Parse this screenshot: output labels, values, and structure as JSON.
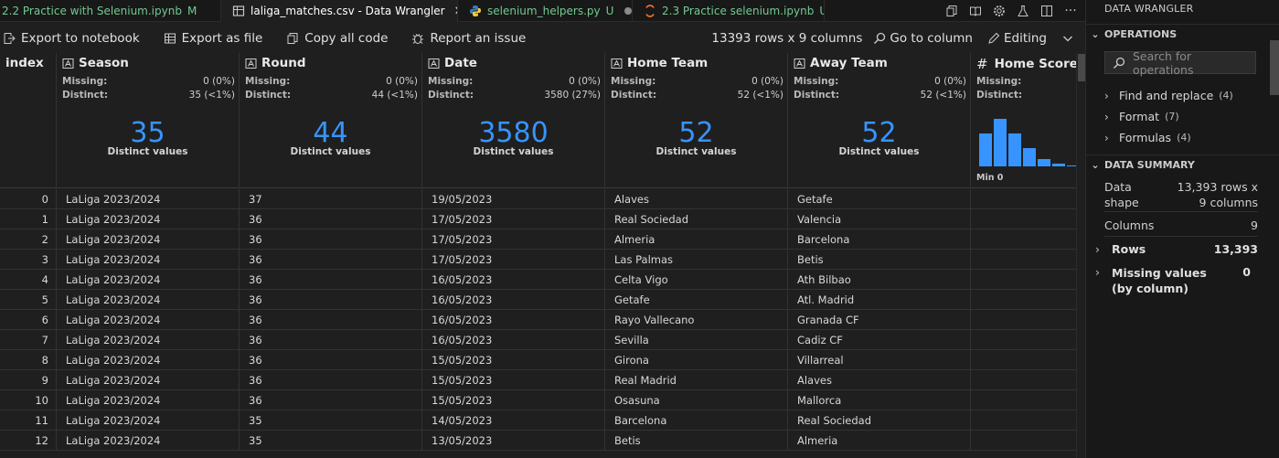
{
  "tabs": [
    {
      "label": "2.2 Practice with Selenium.ipynb",
      "badge": "M",
      "icon": "notebook-icon",
      "color": "#73c991"
    },
    {
      "label": "laliga_matches.csv - Data Wrangler",
      "icon": "table-icon",
      "close": "✕",
      "active": true
    },
    {
      "label": "selenium_helpers.py",
      "badge": "U",
      "icon": "python-icon",
      "color": "#73c991"
    },
    {
      "label": "2.3 Practice selenium.ipynb",
      "badge": "U",
      "icon": "notebook-icon",
      "color": "#73c991"
    }
  ],
  "tab_actions": [
    "copy-icon",
    "book-icon",
    "gear-icon",
    "flask-icon",
    "split-editor-icon",
    "more-icon"
  ],
  "toolbar": {
    "export_notebook": "Export to notebook",
    "export_file": "Export as file",
    "copy_code": "Copy all code",
    "report_issue": "Report an issue",
    "shape": "13393 rows x 9 columns",
    "goto_column": "Go to column",
    "editing": "Editing"
  },
  "stats_labels": {
    "missing": "Missing:",
    "distinct": "Distinct:",
    "distinct_values": "Distinct values",
    "min": "Min 0"
  },
  "columns": [
    {
      "name": "Season",
      "missing": "0 (0%)",
      "distinct": "35 (<1%)",
      "big": "35"
    },
    {
      "name": "Round",
      "missing": "0 (0%)",
      "distinct": "44 (<1%)",
      "big": "44"
    },
    {
      "name": "Date",
      "missing": "0 (0%)",
      "distinct": "3580 (27%)",
      "big": "3580"
    },
    {
      "name": "Home Team",
      "missing": "0 (0%)",
      "distinct": "52 (<1%)",
      "big": "52"
    },
    {
      "name": "Away Team",
      "missing": "0 (0%)",
      "distinct": "52 (<1%)",
      "big": "52"
    },
    {
      "name": "Home Score"
    }
  ],
  "index_header": "index",
  "rows": [
    [
      "0",
      "LaLiga 2023/2024",
      "37",
      "19/05/2023",
      "Alaves",
      "Getafe"
    ],
    [
      "1",
      "LaLiga 2023/2024",
      "36",
      "17/05/2023",
      "Real Sociedad",
      "Valencia"
    ],
    [
      "2",
      "LaLiga 2023/2024",
      "36",
      "17/05/2023",
      "Almeria",
      "Barcelona"
    ],
    [
      "3",
      "LaLiga 2023/2024",
      "36",
      "17/05/2023",
      "Las Palmas",
      "Betis"
    ],
    [
      "4",
      "LaLiga 2023/2024",
      "36",
      "16/05/2023",
      "Celta Vigo",
      "Ath Bilbao"
    ],
    [
      "5",
      "LaLiga 2023/2024",
      "36",
      "16/05/2023",
      "Getafe",
      "Atl. Madrid"
    ],
    [
      "6",
      "LaLiga 2023/2024",
      "36",
      "16/05/2023",
      "Rayo Vallecano",
      "Granada CF"
    ],
    [
      "7",
      "LaLiga 2023/2024",
      "36",
      "16/05/2023",
      "Sevilla",
      "Cadiz CF"
    ],
    [
      "8",
      "LaLiga 2023/2024",
      "36",
      "15/05/2023",
      "Girona",
      "Villarreal"
    ],
    [
      "9",
      "LaLiga 2023/2024",
      "36",
      "15/05/2023",
      "Real Madrid",
      "Alaves"
    ],
    [
      "10",
      "LaLiga 2023/2024",
      "36",
      "15/05/2023",
      "Osasuna",
      "Mallorca"
    ],
    [
      "11",
      "LaLiga 2023/2024",
      "35",
      "14/05/2023",
      "Barcelona",
      "Real Sociedad"
    ],
    [
      "12",
      "LaLiga 2023/2024",
      "35",
      "13/05/2023",
      "Betis",
      "Almeria"
    ]
  ],
  "panel": {
    "title": "DATA WRANGLER",
    "operations": "OPERATIONS",
    "search_placeholder": "Search for operations",
    "ops": [
      {
        "label": "Find and replace",
        "count": "(4)"
      },
      {
        "label": "Format",
        "count": "(7)"
      },
      {
        "label": "Formulas",
        "count": "(4)"
      }
    ],
    "summary": "DATA SUMMARY",
    "data_shape_label": "Data shape",
    "data_shape_value": "13,393 rows x 9 columns",
    "columns_label": "Columns",
    "columns_value": "9",
    "rows_label": "Rows",
    "rows_value": "13,393",
    "missing_label": "Missing values (by column)",
    "missing_value": "0"
  },
  "colors": {
    "accent": "#3794ff",
    "git_badge": "#73c991"
  }
}
